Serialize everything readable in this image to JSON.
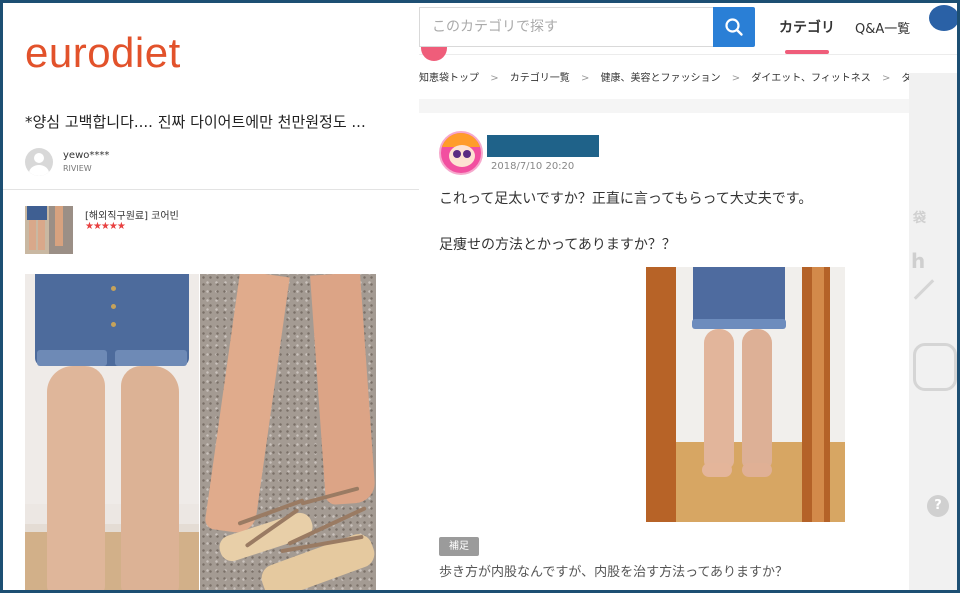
{
  "left": {
    "logo": "eurodiet",
    "post_title": "*양심 고백합니다.... 진짜 다이어트에만 천만원정도 ...",
    "user": {
      "name": "yewo****",
      "sub": "RIVIEW"
    },
    "product": {
      "name": "[해외직구원료] 코어빈",
      "stars": "★★★★★"
    }
  },
  "right": {
    "search": {
      "placeholder": "このカテゴリで探す"
    },
    "tabs": {
      "category": "カテゴリ",
      "qa": "Q&A一覧"
    },
    "breadcrumb": [
      "知恵袋トップ",
      "カテゴリ一覧",
      "健康、美容とファッション",
      "ダイエット、フィットネス",
      "ダイ"
    ],
    "breadcrumb_separator": ">",
    "question": {
      "date": "2018/7/10 20:20",
      "line1": "これって足太いですか？正直に言ってもらって大丈夫です。",
      "line2": "足痩せの方法とかってありますか？？"
    },
    "supplement": {
      "badge": "補足",
      "text": "歩き方が内股なんですが、内股を治す方法ってありますか？"
    }
  },
  "colors": {
    "brand": "#e2522b",
    "search_button": "#2a7fd6",
    "tab_underline": "#ef5d7a",
    "frame": "#1d4f73",
    "stars": "#e84141"
  },
  "icons": {
    "search": "search-icon",
    "avatar": "default-avatar-icon"
  }
}
